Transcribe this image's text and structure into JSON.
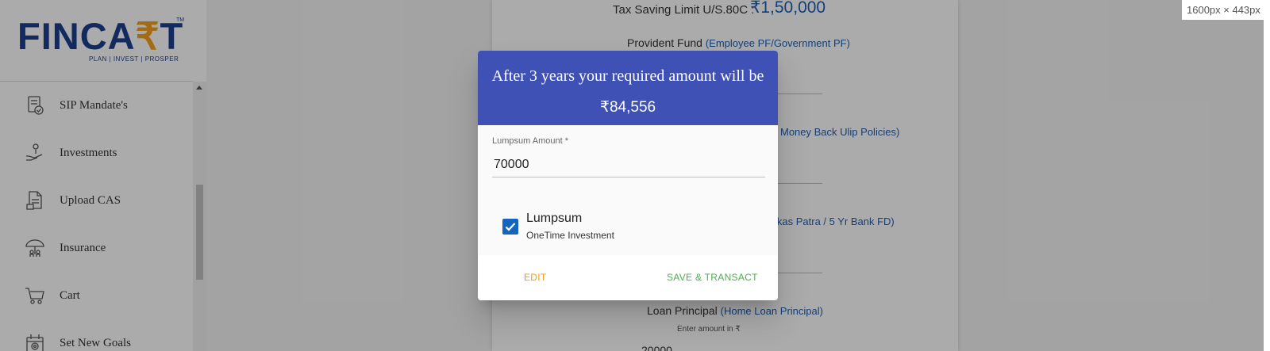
{
  "brand": {
    "logo_text_start": "FINCA",
    "logo_symbol": "₹",
    "logo_text_end": "T",
    "trademark": "TM",
    "tagline": "PLAN | INVEST | PROSPER"
  },
  "sidebar": {
    "items": [
      {
        "label": "SIP Mandate's",
        "icon": "mandate-icon"
      },
      {
        "label": "Investments",
        "icon": "investments-icon"
      },
      {
        "label": "Upload CAS",
        "icon": "upload-cas-icon"
      },
      {
        "label": "Insurance",
        "icon": "insurance-icon"
      },
      {
        "label": "Cart",
        "icon": "cart-icon"
      },
      {
        "label": "Set New Goals",
        "icon": "set-goals-icon"
      }
    ]
  },
  "page": {
    "tax_limit_label": "Tax Saving Limit U/S.80C : ",
    "tax_limit_value": "₹1,50,000",
    "provident_fund_label": "Provident Fund",
    "provident_fund_hint": "(Employee PF/Government PF)",
    "ulip_hint_fragment": "Money Back Ulip Policies)",
    "savings_hint_fragment": "ikas Patra / 5 Yr Bank FD)",
    "loan_label": "Loan Principal",
    "loan_hint": "(Home Loan Principal)",
    "enter_amount_hint": "Enter amount in ₹",
    "loan_value_partial": "20000"
  },
  "screen_size_badge": "1600px × 443px",
  "dialog": {
    "title": "After 3 years your required amount will be",
    "amount": "₹84,556",
    "lumpsum_label": "Lumpsum Amount *",
    "lumpsum_value": "70000",
    "checkbox_title": "Lumpsum",
    "checkbox_subtitle": "OneTime Investment",
    "checkbox_checked": true,
    "edit_label": "EDIT",
    "save_label": "SAVE & TRANSACT"
  },
  "colors": {
    "dialog_header": "#3f51b5",
    "edit_button": "#f39c12",
    "save_button": "#4caf50",
    "checkbox": "#1565c0",
    "link_blue": "#1e5fb4",
    "brand_blue": "#1b3f8f",
    "brand_orange": "#f5a01a"
  }
}
